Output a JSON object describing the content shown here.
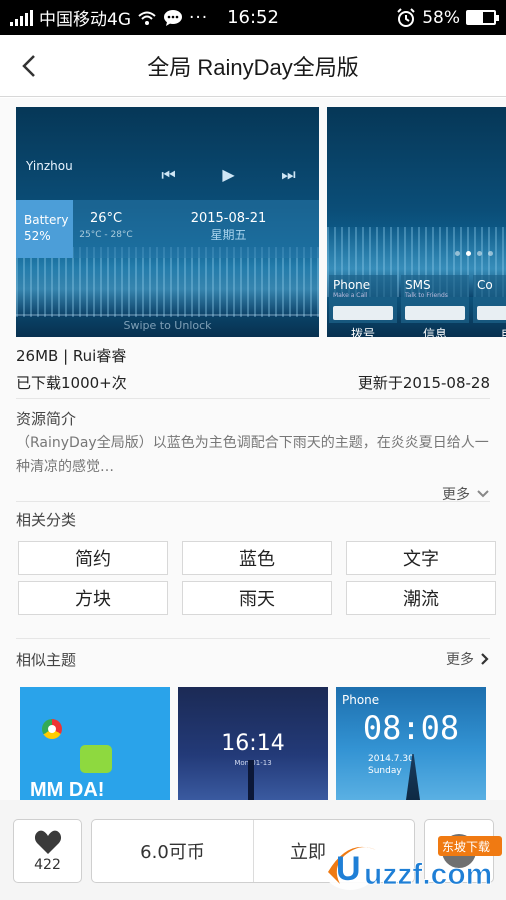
{
  "status_bar": {
    "carrier": "中国移动4G",
    "time": "16:52",
    "battery": "58%",
    "battery_level": 0.58,
    "icons": [
      "signal-icon",
      "wifi-icon",
      "message-icon",
      "more-dots-icon",
      "alarm-icon",
      "battery-icon"
    ]
  },
  "header": {
    "title": "全局 RainyDay全局版",
    "back_icon": "chevron-left-icon"
  },
  "screenshots": {
    "lock": {
      "city": "Yinzhou",
      "battery_label": "Battery",
      "battery_value": "52%",
      "temperature": "26°C",
      "temperature_range": "25°C - 28°C",
      "date": "2015-08-21",
      "weekday": "星期五",
      "swipe_hint": "Swipe to Unlock"
    },
    "home": {
      "apps": [
        {
          "name": "Phone",
          "sub": "Make a Call"
        },
        {
          "name": "SMS",
          "sub": "Talk to Friends"
        },
        {
          "name": "Co",
          "sub": ""
        }
      ],
      "labels": [
        "拨号",
        "信息",
        "电"
      ]
    }
  },
  "meta": {
    "size_author": "26MB | Rui睿睿",
    "downloads": "已下载1000+次",
    "updated": "更新于2015-08-28"
  },
  "intro": {
    "heading": "资源简介",
    "text": "（RainyDay全局版）以蓝色为主色调配合下雨天的主题，在炎炎夏日给人一种清凉的感觉…",
    "more": "更多"
  },
  "categories": {
    "heading": "相关分类",
    "tags": [
      "简约",
      "蓝色",
      "文字",
      "方块",
      "雨天",
      "潮流"
    ]
  },
  "similar": {
    "heading": "相似主题",
    "more": "更多",
    "items": [
      {
        "caption": "MM DA!"
      },
      {
        "time": "16:14",
        "date": "Mon 01-13"
      },
      {
        "label": "Phone",
        "time": "08:08",
        "date": "2014.7.30",
        "weekday": "Sunday"
      }
    ]
  },
  "bottom_bar": {
    "like_count": "422",
    "price": "6.0可币",
    "action": "立即"
  },
  "watermark": {
    "text": "uzzf.com",
    "tagline": "东坡下载"
  }
}
